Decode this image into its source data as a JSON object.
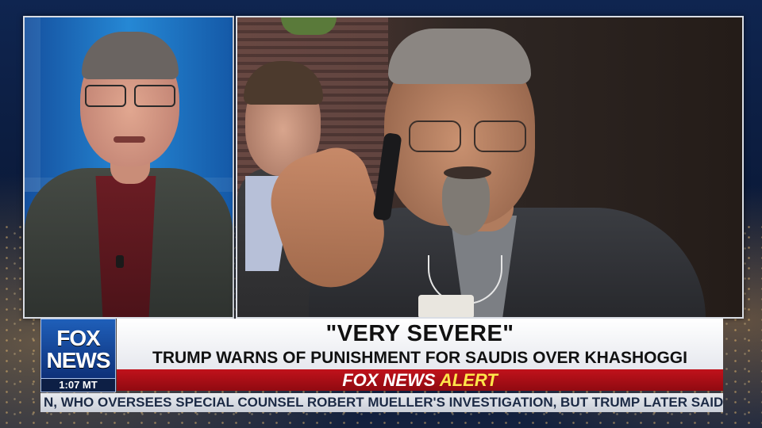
{
  "network": {
    "logo_top": "FOX",
    "logo_bottom": "NEWS",
    "time": "1:07 MT"
  },
  "lower_third": {
    "headline": "\"VERY SEVERE\"",
    "subheadline": "TRUMP WARNS OF PUNISHMENT FOR SAUDIS OVER KHASHOGGI"
  },
  "alert": {
    "prefix": "FOX NEWS",
    "word": "ALERT"
  },
  "ticker": {
    "text": "N, WHO OVERSEES SPECIAL COUNSEL ROBERT MUELLER'S INVESTIGATION, BUT TRUMP LATER SAID ROSENST"
  },
  "colors": {
    "alert_red": "#c1121b",
    "brand_blue": "#1f5fb9",
    "alert_yellow": "#ffe64a"
  }
}
